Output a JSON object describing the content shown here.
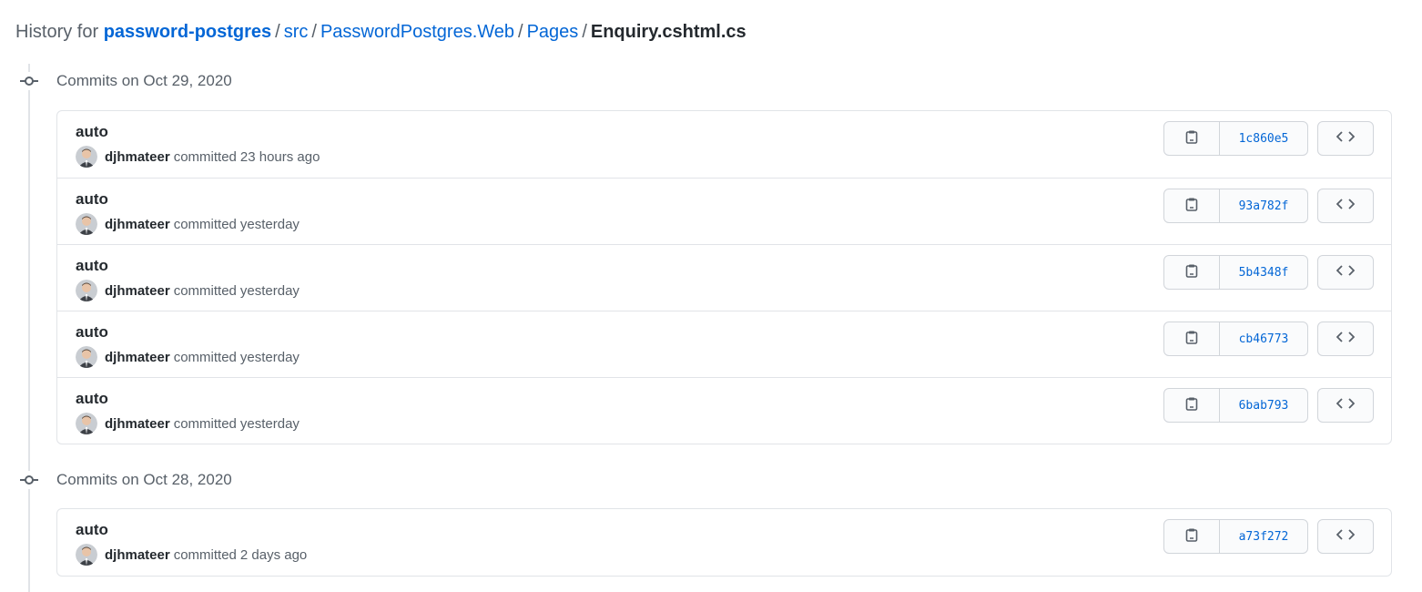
{
  "header": {
    "prefix": "History for",
    "repo": "password-postgres",
    "path": [
      "src",
      "PasswordPostgres.Web",
      "Pages"
    ],
    "file": "Enquiry.cshtml.cs",
    "separator": "/"
  },
  "groups": [
    {
      "title": "Commits on Oct 29, 2020",
      "commits": [
        {
          "message": "auto",
          "author": "djhmateer",
          "verb": "committed",
          "time": "23 hours ago",
          "sha": "1c860e5"
        },
        {
          "message": "auto",
          "author": "djhmateer",
          "verb": "committed",
          "time": "yesterday",
          "sha": "93a782f"
        },
        {
          "message": "auto",
          "author": "djhmateer",
          "verb": "committed",
          "time": "yesterday",
          "sha": "5b4348f"
        },
        {
          "message": "auto",
          "author": "djhmateer",
          "verb": "committed",
          "time": "yesterday",
          "sha": "cb46773"
        },
        {
          "message": "auto",
          "author": "djhmateer",
          "verb": "committed",
          "time": "yesterday",
          "sha": "6bab793"
        }
      ]
    },
    {
      "title": "Commits on Oct 28, 2020",
      "commits": [
        {
          "message": "auto",
          "author": "djhmateer",
          "verb": "committed",
          "time": "2 days ago",
          "sha": "a73f272"
        }
      ]
    }
  ],
  "icons": {
    "commit": "git-commit-icon",
    "copy": "clipboard-icon",
    "browse": "code-icon",
    "avatar": "user-avatar"
  },
  "colors": {
    "link": "#0366d6",
    "text": "#24292e",
    "muted": "#586069",
    "border": "#e1e4e8"
  }
}
